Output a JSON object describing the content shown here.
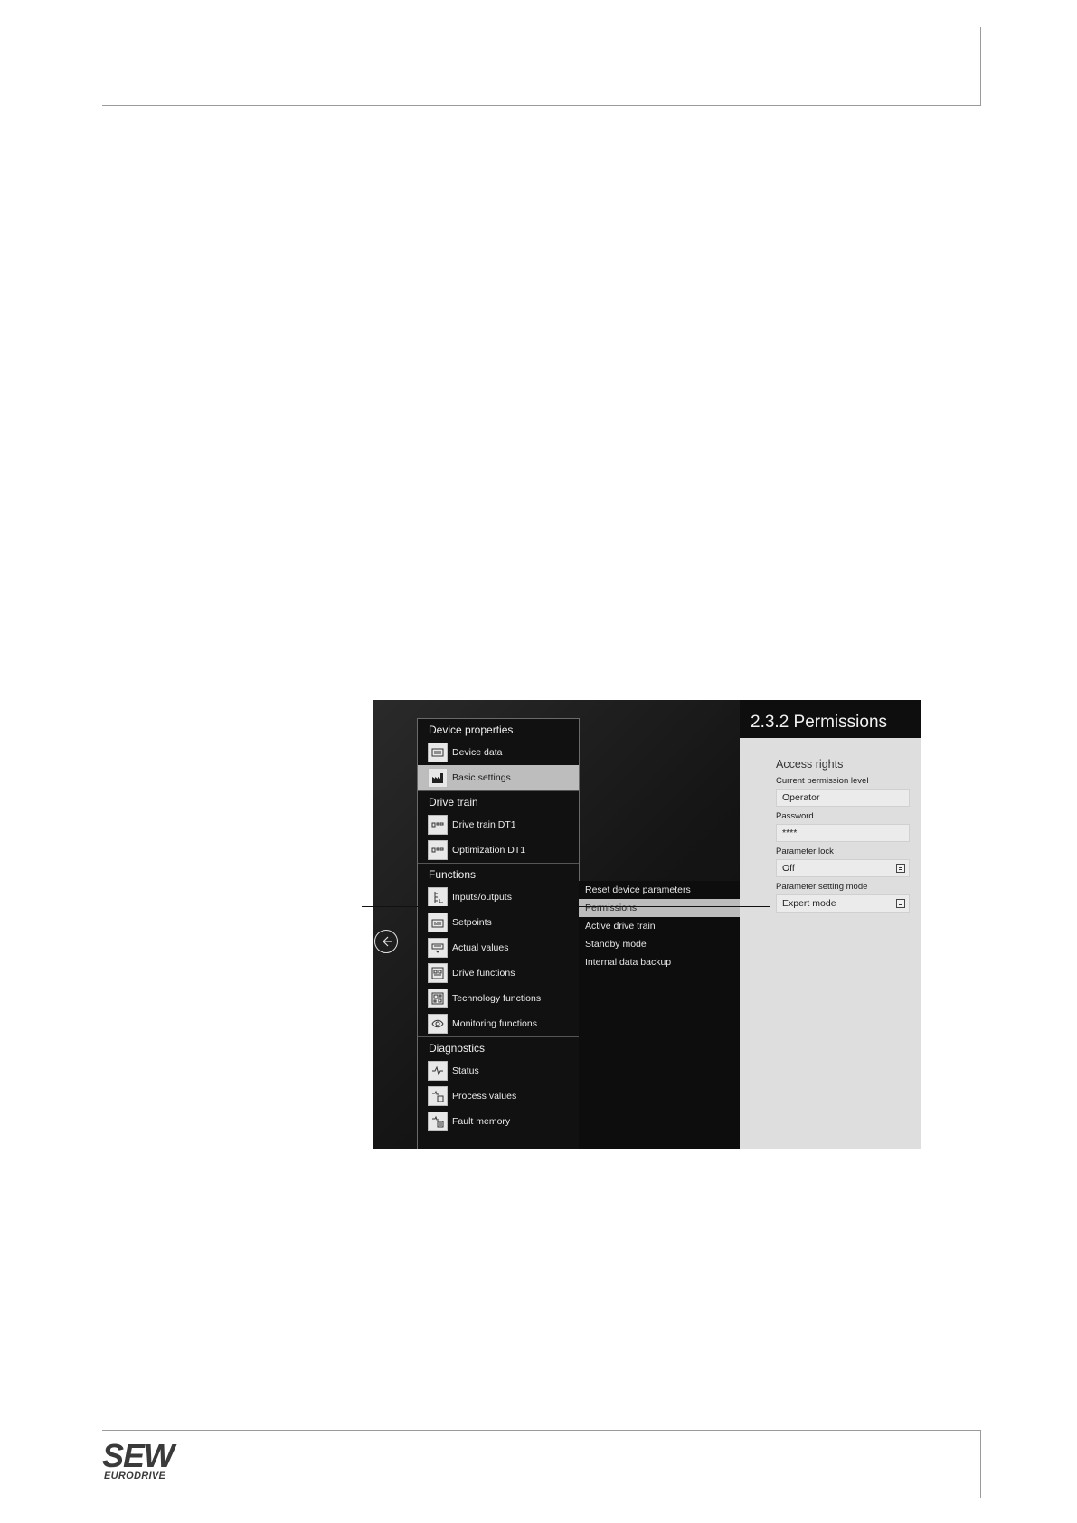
{
  "logo": {
    "primary": "SEW",
    "secondary": "EURODRIVE"
  },
  "app": {
    "panel_title": "2.3.2 Permissions",
    "nav": {
      "groups": [
        {
          "label": "Device properties",
          "items": [
            {
              "label": "Device data",
              "icon": "device-data-icon",
              "selected": false
            },
            {
              "label": "Basic settings",
              "icon": "factory-icon",
              "selected": true
            }
          ]
        },
        {
          "label": "Drive train",
          "items": [
            {
              "label": "Drive train DT1",
              "icon": "drive-train-icon",
              "selected": false
            },
            {
              "label": "Optimization DT1",
              "icon": "drive-train-icon",
              "selected": false
            }
          ]
        },
        {
          "label": "Functions",
          "items": [
            {
              "label": "Inputs/outputs",
              "icon": "io-icon",
              "selected": false
            },
            {
              "label": "Setpoints",
              "icon": "setpoints-icon",
              "selected": false
            },
            {
              "label": "Actual values",
              "icon": "actual-values-icon",
              "selected": false
            },
            {
              "label": "Drive functions",
              "icon": "drive-functions-icon",
              "selected": false
            },
            {
              "label": "Technology functions",
              "icon": "technology-functions-icon",
              "selected": false
            },
            {
              "label": "Monitoring functions",
              "icon": "eye-icon",
              "selected": false
            }
          ]
        },
        {
          "label": "Diagnostics",
          "items": [
            {
              "label": "Status",
              "icon": "pulse-icon",
              "selected": false
            },
            {
              "label": "Process values",
              "icon": "process-values-icon",
              "selected": false
            },
            {
              "label": "Fault memory",
              "icon": "fault-memory-icon",
              "selected": false
            }
          ]
        }
      ]
    },
    "submenu": [
      {
        "label": "Reset device parameters",
        "selected": false
      },
      {
        "label": "Permissions",
        "selected": true
      },
      {
        "label": "Active drive train",
        "selected": false
      },
      {
        "label": "Standby mode",
        "selected": false
      },
      {
        "label": "Internal data backup",
        "selected": false
      }
    ],
    "panel": {
      "section_title": "Access rights",
      "fields": [
        {
          "label": "Current permission level",
          "value": "Operator",
          "dropdown": false
        },
        {
          "label": "Password",
          "value": "****",
          "dropdown": false
        },
        {
          "label": "Parameter lock",
          "value": "Off",
          "dropdown": true
        },
        {
          "label": "Parameter setting mode",
          "value": "Expert mode",
          "dropdown": true
        }
      ]
    }
  }
}
